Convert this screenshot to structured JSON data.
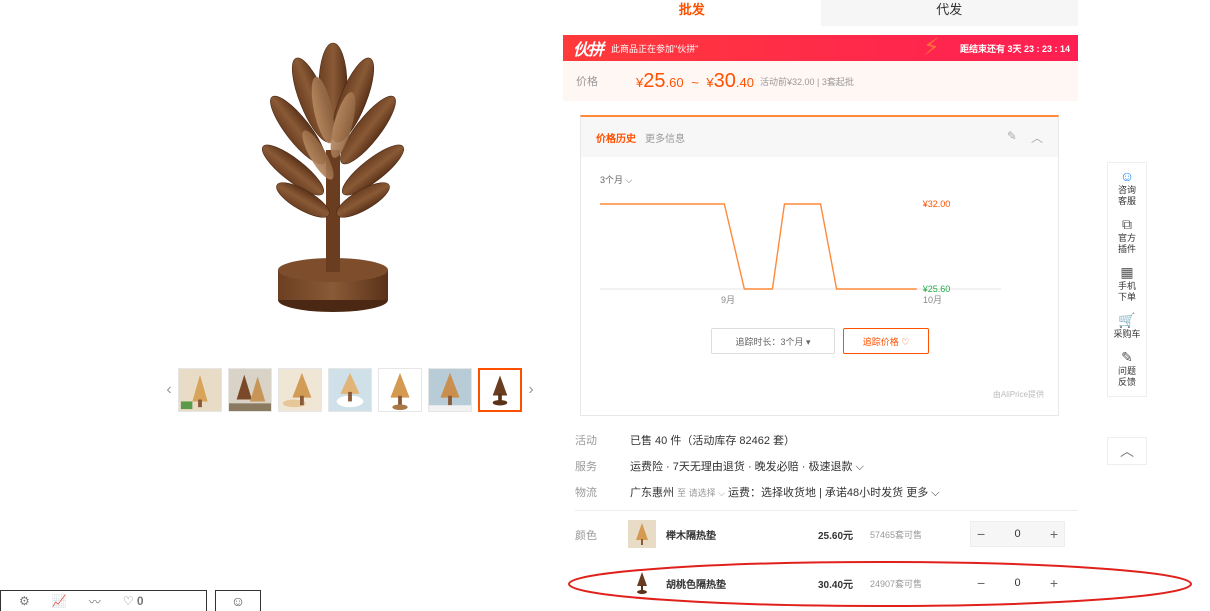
{
  "tabs": [
    {
      "label": "批发",
      "active": true
    },
    {
      "label": "代发",
      "active": false
    }
  ],
  "promo": {
    "logo": "伙拼",
    "text": "此商品正在参加\"伙拼\"",
    "countdown": "距结束还有 3天 23 : 23 : 14"
  },
  "price": {
    "label": "价格",
    "currency": "¥",
    "low_int": "25",
    "low_dec": ".60",
    "separator": "~",
    "high_int": "30",
    "high_dec": ".40",
    "note": "活动前¥32.00 | 3套起批"
  },
  "price_history": {
    "tab_active": "价格历史",
    "tab_other": "更多信息",
    "range": "3个月 ⌵",
    "duration_button": "追踪时长：3个月 ▾",
    "follow_button": "追踪价格 ♡",
    "source": "由AliPrice提供"
  },
  "chart_data": {
    "type": "line",
    "x_tick_labels": [
      "9月",
      "10月"
    ],
    "series": [
      {
        "points": [
          [
            0,
            32.0
          ],
          [
            0.31,
            32.0
          ],
          [
            0.36,
            25.6
          ],
          [
            0.43,
            25.6
          ],
          [
            0.46,
            32.0
          ],
          [
            0.55,
            32.0
          ],
          [
            0.59,
            25.6
          ],
          [
            0.79,
            25.6
          ]
        ]
      }
    ],
    "y_labels": [
      "¥32.00",
      "¥25.60"
    ],
    "ylim": [
      25.6,
      32.0
    ],
    "color": "#ff8a3a"
  },
  "info": {
    "activity_label": "活动",
    "activity_value": "已售 40 件（活动库存 82462 套）",
    "service_label": "服务",
    "service_value": "运费险 · 7天无理由退货 · 晚发必赔 · 极速退款 ⌵",
    "logistics_label": "物流",
    "logistics_from": "广东惠州",
    "logistics_to": "至 请选择 ⌵",
    "logistics_rest": " 运费：选择收货地 | 承诺48小时发货 更多 ⌵"
  },
  "sku": {
    "color_label": "颜色",
    "items": [
      {
        "name": "榉木隔热垫",
        "price": "25.60元",
        "stock": "57465套可售",
        "qty": "0"
      },
      {
        "name": "胡桃色隔热垫",
        "price": "30.40元",
        "stock": "24907套可售",
        "qty": "0"
      }
    ]
  },
  "sidebar": {
    "items": [
      {
        "icon": "☺",
        "label": "咨询客服"
      },
      {
        "icon": "⧉",
        "label": "官方插件"
      },
      {
        "icon": "▦",
        "label": "手机下单"
      },
      {
        "icon": "🛒",
        "label": "采购车"
      },
      {
        "icon": "✎",
        "label": "问题反馈"
      }
    ],
    "top_icon": "︿"
  },
  "bottom_bar": {
    "heart_count": "0"
  },
  "colors": {
    "accent": "#ff5000",
    "promo_red": "#ff2a4a",
    "annotation": "#e0201b"
  }
}
